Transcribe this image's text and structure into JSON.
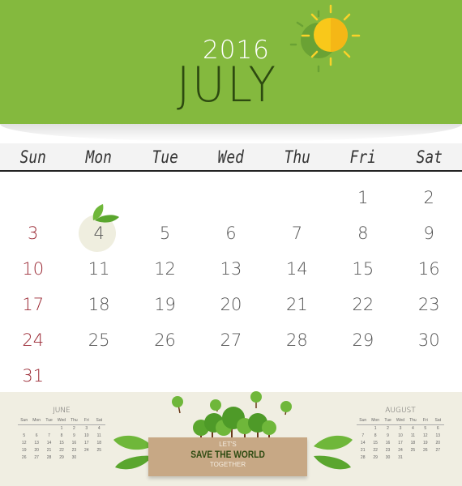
{
  "header": {
    "year": "2016",
    "month": "JULY"
  },
  "colors": {
    "header_green": "#84b93e",
    "sunday_red": "#9b2a35",
    "text_gray": "#555555",
    "footer_bg": "#f0eee2",
    "banner_tan": "#c7a885",
    "sun_yellow": "#f9c81a"
  },
  "weekdays": [
    "Sun",
    "Mon",
    "Tue",
    "Wed",
    "Thu",
    "Fri",
    "Sat"
  ],
  "calendar": {
    "today": "4",
    "weeks": [
      [
        "",
        "",
        "",
        "",
        "",
        "1",
        "2"
      ],
      [
        "3",
        "4",
        "5",
        "6",
        "7",
        "8",
        "9"
      ],
      [
        "10",
        "11",
        "12",
        "13",
        "14",
        "15",
        "16"
      ],
      [
        "17",
        "18",
        "19",
        "20",
        "21",
        "22",
        "23"
      ],
      [
        "24",
        "25",
        "26",
        "27",
        "28",
        "29",
        "30"
      ],
      [
        "31",
        "",
        "",
        "",
        "",
        "",
        ""
      ]
    ]
  },
  "mini_prev": {
    "name": "JUNE",
    "weekdays": [
      "Sun",
      "Mon",
      "Tue",
      "Wed",
      "Thu",
      "Fri",
      "Sat"
    ],
    "weeks": [
      [
        "",
        "",
        "",
        "1",
        "2",
        "3",
        "4"
      ],
      [
        "5",
        "6",
        "7",
        "8",
        "9",
        "10",
        "11"
      ],
      [
        "12",
        "13",
        "14",
        "15",
        "16",
        "17",
        "18"
      ],
      [
        "19",
        "20",
        "21",
        "22",
        "23",
        "24",
        "25"
      ],
      [
        "26",
        "27",
        "28",
        "29",
        "30",
        "",
        ""
      ]
    ]
  },
  "mini_next": {
    "name": "AUGUST",
    "weekdays": [
      "Sun",
      "Mon",
      "Tue",
      "Wed",
      "Thu",
      "Fri",
      "Sat"
    ],
    "weeks": [
      [
        "",
        "1",
        "2",
        "3",
        "4",
        "5",
        "6"
      ],
      [
        "7",
        "8",
        "9",
        "10",
        "11",
        "12",
        "13"
      ],
      [
        "14",
        "15",
        "16",
        "17",
        "18",
        "19",
        "20"
      ],
      [
        "21",
        "22",
        "23",
        "24",
        "25",
        "26",
        "27"
      ],
      [
        "28",
        "29",
        "30",
        "31",
        "",
        "",
        ""
      ]
    ]
  },
  "banner": {
    "line1": "LET'S",
    "line2": "SAVE THE WORLD",
    "line3": "TOGETHER"
  },
  "icons": {
    "sun": "sun-icon",
    "leaves": "leaves-icon",
    "trees": "trees-illustration"
  }
}
